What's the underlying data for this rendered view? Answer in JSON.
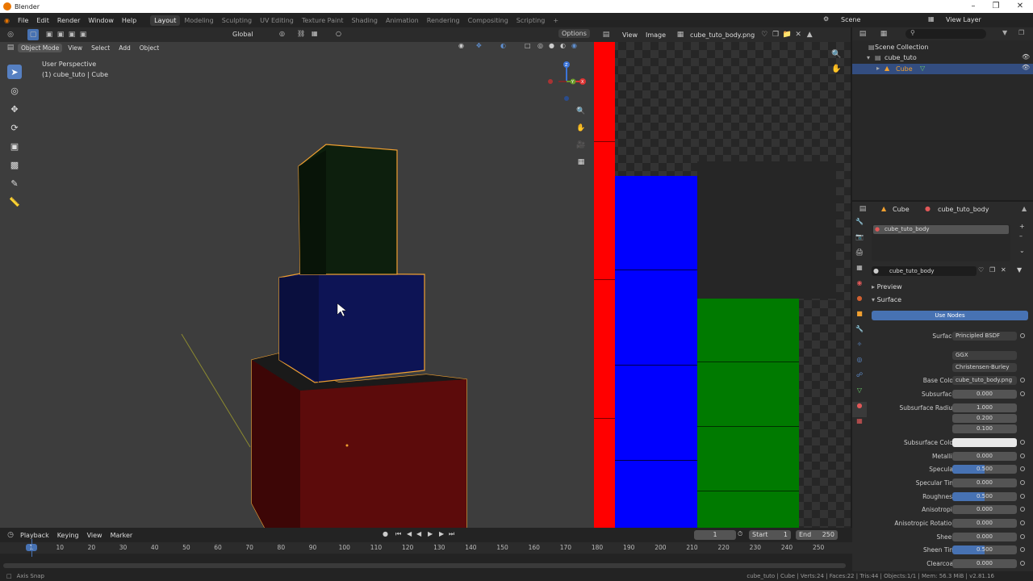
{
  "app": {
    "title": "Blender"
  },
  "menu": [
    "File",
    "Edit",
    "Render",
    "Window",
    "Help"
  ],
  "workspaces": [
    {
      "label": "Layout",
      "active": true
    },
    {
      "label": "Modeling"
    },
    {
      "label": "Sculpting"
    },
    {
      "label": "UV Editing"
    },
    {
      "label": "Texture Paint"
    },
    {
      "label": "Shading"
    },
    {
      "label": "Animation"
    },
    {
      "label": "Rendering"
    },
    {
      "label": "Compositing"
    },
    {
      "label": "Scripting"
    }
  ],
  "scene": {
    "label": "Scene",
    "view_layer": "View Layer"
  },
  "viewport": {
    "transform_orientation": "Global",
    "options": "Options",
    "mode": "Object Mode",
    "menus": [
      "View",
      "Select",
      "Add",
      "Object"
    ],
    "overlay_title": "User Perspective",
    "overlay_object": "(1) cube_tuto | Cube",
    "gizmo_axes": {
      "x": "X",
      "y": "Y",
      "z": "Z"
    }
  },
  "image_editor": {
    "menus": [
      "View",
      "Image"
    ],
    "image_name": "cube_tuto_body.png"
  },
  "outliner": {
    "root": "Scene Collection",
    "collection": "cube_tuto",
    "object": "Cube"
  },
  "properties": {
    "object": "Cube",
    "material": "cube_tuto_body",
    "slot": "cube_tuto_body",
    "material_field": "cube_tuto_body",
    "preview": "Preview",
    "surface_panel": "Surface",
    "use_nodes": "Use Nodes",
    "rows": [
      {
        "label": "Surface",
        "value": "Principled BSDF",
        "style": "dark"
      },
      {
        "label": "",
        "value": "GGX",
        "style": "dark"
      },
      {
        "label": "",
        "value": "Christensen-Burley",
        "style": "dark"
      },
      {
        "label": "Base Color",
        "value": "cube_tuto_body.png",
        "style": "dark"
      },
      {
        "label": "Subsurface",
        "value": "0.000",
        "style": "plain"
      },
      {
        "label": "Subsurface Radius",
        "value": "1.000",
        "style": "plain"
      },
      {
        "label": "",
        "value": "0.200",
        "style": "plain"
      },
      {
        "label": "",
        "value": "0.100",
        "style": "plain"
      },
      {
        "label": "Subsurface Color",
        "value": "",
        "style": "white"
      },
      {
        "label": "Metallic",
        "value": "0.000",
        "style": "plain"
      },
      {
        "label": "Specular",
        "value": "0.500",
        "style": "blue"
      },
      {
        "label": "Specular Tint",
        "value": "0.000",
        "style": "plain"
      },
      {
        "label": "Roughness",
        "value": "0.500",
        "style": "blue"
      },
      {
        "label": "Anisotropic",
        "value": "0.000",
        "style": "plain"
      },
      {
        "label": "Anisotropic Rotation",
        "value": "0.000",
        "style": "plain"
      },
      {
        "label": "Sheen",
        "value": "0.000",
        "style": "plain"
      },
      {
        "label": "Sheen Tint",
        "value": "0.500",
        "style": "blue"
      },
      {
        "label": "Clearcoat",
        "value": "0.000",
        "style": "plain"
      }
    ]
  },
  "timeline": {
    "menus": [
      "Playback",
      "Keying",
      "View",
      "Marker"
    ],
    "current_frame": "1",
    "start_label": "Start",
    "start": "1",
    "end_label": "End",
    "end": "250",
    "ruler": [
      "1",
      "10",
      "20",
      "30",
      "40",
      "50",
      "60",
      "70",
      "80",
      "90",
      "100",
      "110",
      "120",
      "130",
      "140",
      "150",
      "160",
      "170",
      "180",
      "190",
      "200",
      "210",
      "220",
      "230",
      "240",
      "250"
    ]
  },
  "status": {
    "left": "Axis Snap",
    "right": "cube_tuto | Cube | Verts:24 | Faces:22 | Tris:44 | Objects:1/1 | Mem: 56.3 MiB | v2.81.16"
  },
  "colors": {
    "accent": "#4772b3",
    "selection_outline": "#f0a030",
    "cube_red": "#5c0b0b",
    "cube_blue": "#0d1455",
    "cube_green": "#0d1f0d",
    "uv_red": "#ff0000",
    "uv_blue": "#0000ff",
    "uv_green": "#007a00"
  }
}
